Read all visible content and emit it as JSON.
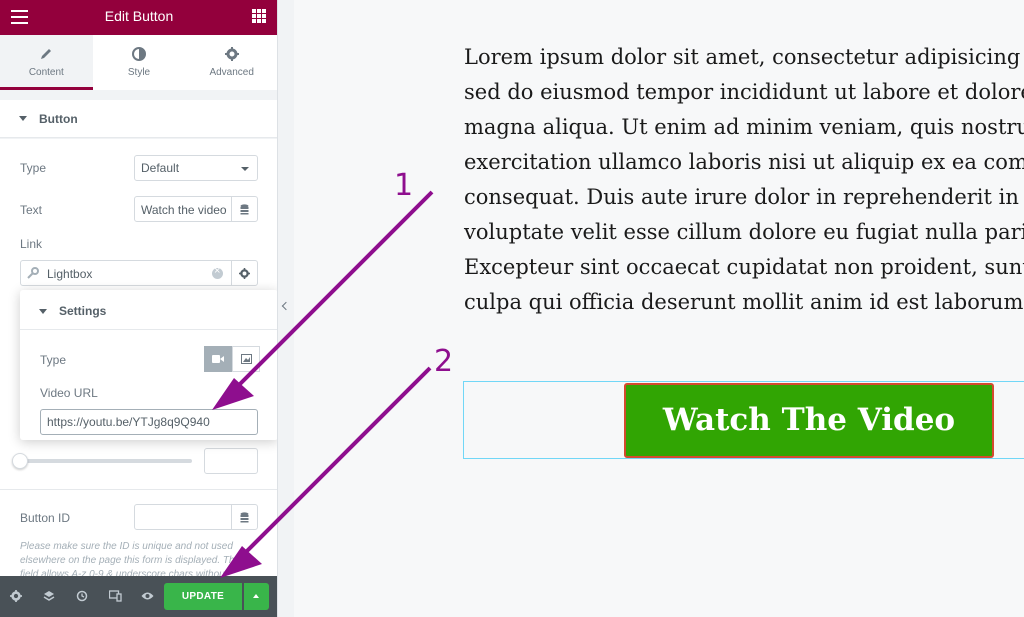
{
  "header": {
    "title": "Edit Button"
  },
  "tabs": [
    {
      "label": "Content"
    },
    {
      "label": "Style"
    },
    {
      "label": "Advanced"
    }
  ],
  "section": {
    "title": "Button"
  },
  "controls": {
    "type_label": "Type",
    "type_value": "Default",
    "text_label": "Text",
    "text_value": "Watch the video",
    "link_label": "Link",
    "link_value": "Lightbox",
    "button_id_label": "Button ID",
    "button_id_value": "",
    "note": "Please make sure the ID is unique and not used elsewhere on the page this form is displayed. This field allows A-z 0-9 & underscore chars without spaces."
  },
  "popover": {
    "title": "Settings",
    "type_label": "Type",
    "url_label": "Video URL",
    "url_value": "https://youtu.be/YTJg8q9Q940"
  },
  "footer": {
    "update_label": "UPDATE"
  },
  "preview": {
    "paragraph": "Lorem ipsum dolor sit amet, consectetur adipisicing elit,\nsed do eiusmod tempor incididunt ut labore et dolore\nmagna aliqua. Ut enim ad minim veniam, quis nostrud\nexercitation ullamco laboris nisi ut aliquip ex ea commodo\nconsequat. Duis aute irure dolor in reprehenderit in\nvoluptate velit esse cillum dolore eu fugiat nulla pariatur.\nExcepteur sint occaecat cupidatat non proident, sunt in\nculpa qui officia deserunt mollit anim id est laborum.",
    "button_label": "Watch The Video"
  },
  "annotations": [
    "1",
    "2"
  ],
  "colors": {
    "brand": "#93003c",
    "update": "#39b54a",
    "watch_button": "#31a503",
    "watch_border": "#d34a2f",
    "arrow": "#8e0e8e"
  }
}
